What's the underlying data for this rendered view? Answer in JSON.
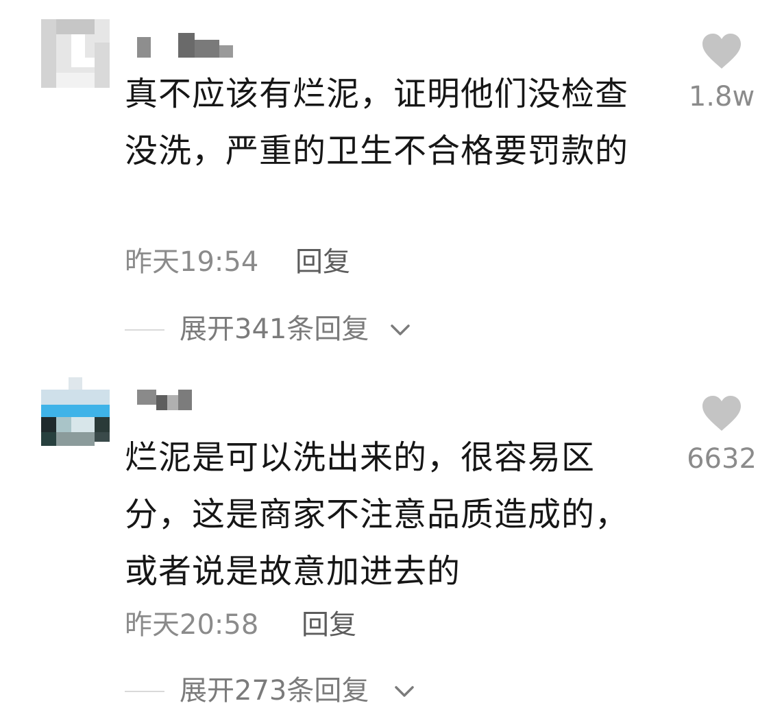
{
  "comments": [
    {
      "text": "真不应该有烂泥，证明他们没检查没洗，严重的卫生不合格要罚款的",
      "time": "昨天19:54",
      "reply_label": "回复",
      "expand_label": "展开341条回复",
      "likes": "1.8w"
    },
    {
      "text": "烂泥是可以洗出来的，很容易区分，这是商家不注意品质造成的，或者说是故意加进去的",
      "time": "昨天20:58",
      "reply_label": "回复",
      "expand_label": "展开273条回复",
      "likes": "6632"
    }
  ],
  "icons": {
    "like": "heart-icon",
    "expand": "chevron-down-icon"
  },
  "colors": {
    "text": "#161616",
    "meta": "#8b8b8b",
    "heart": "#c4c4c4"
  }
}
